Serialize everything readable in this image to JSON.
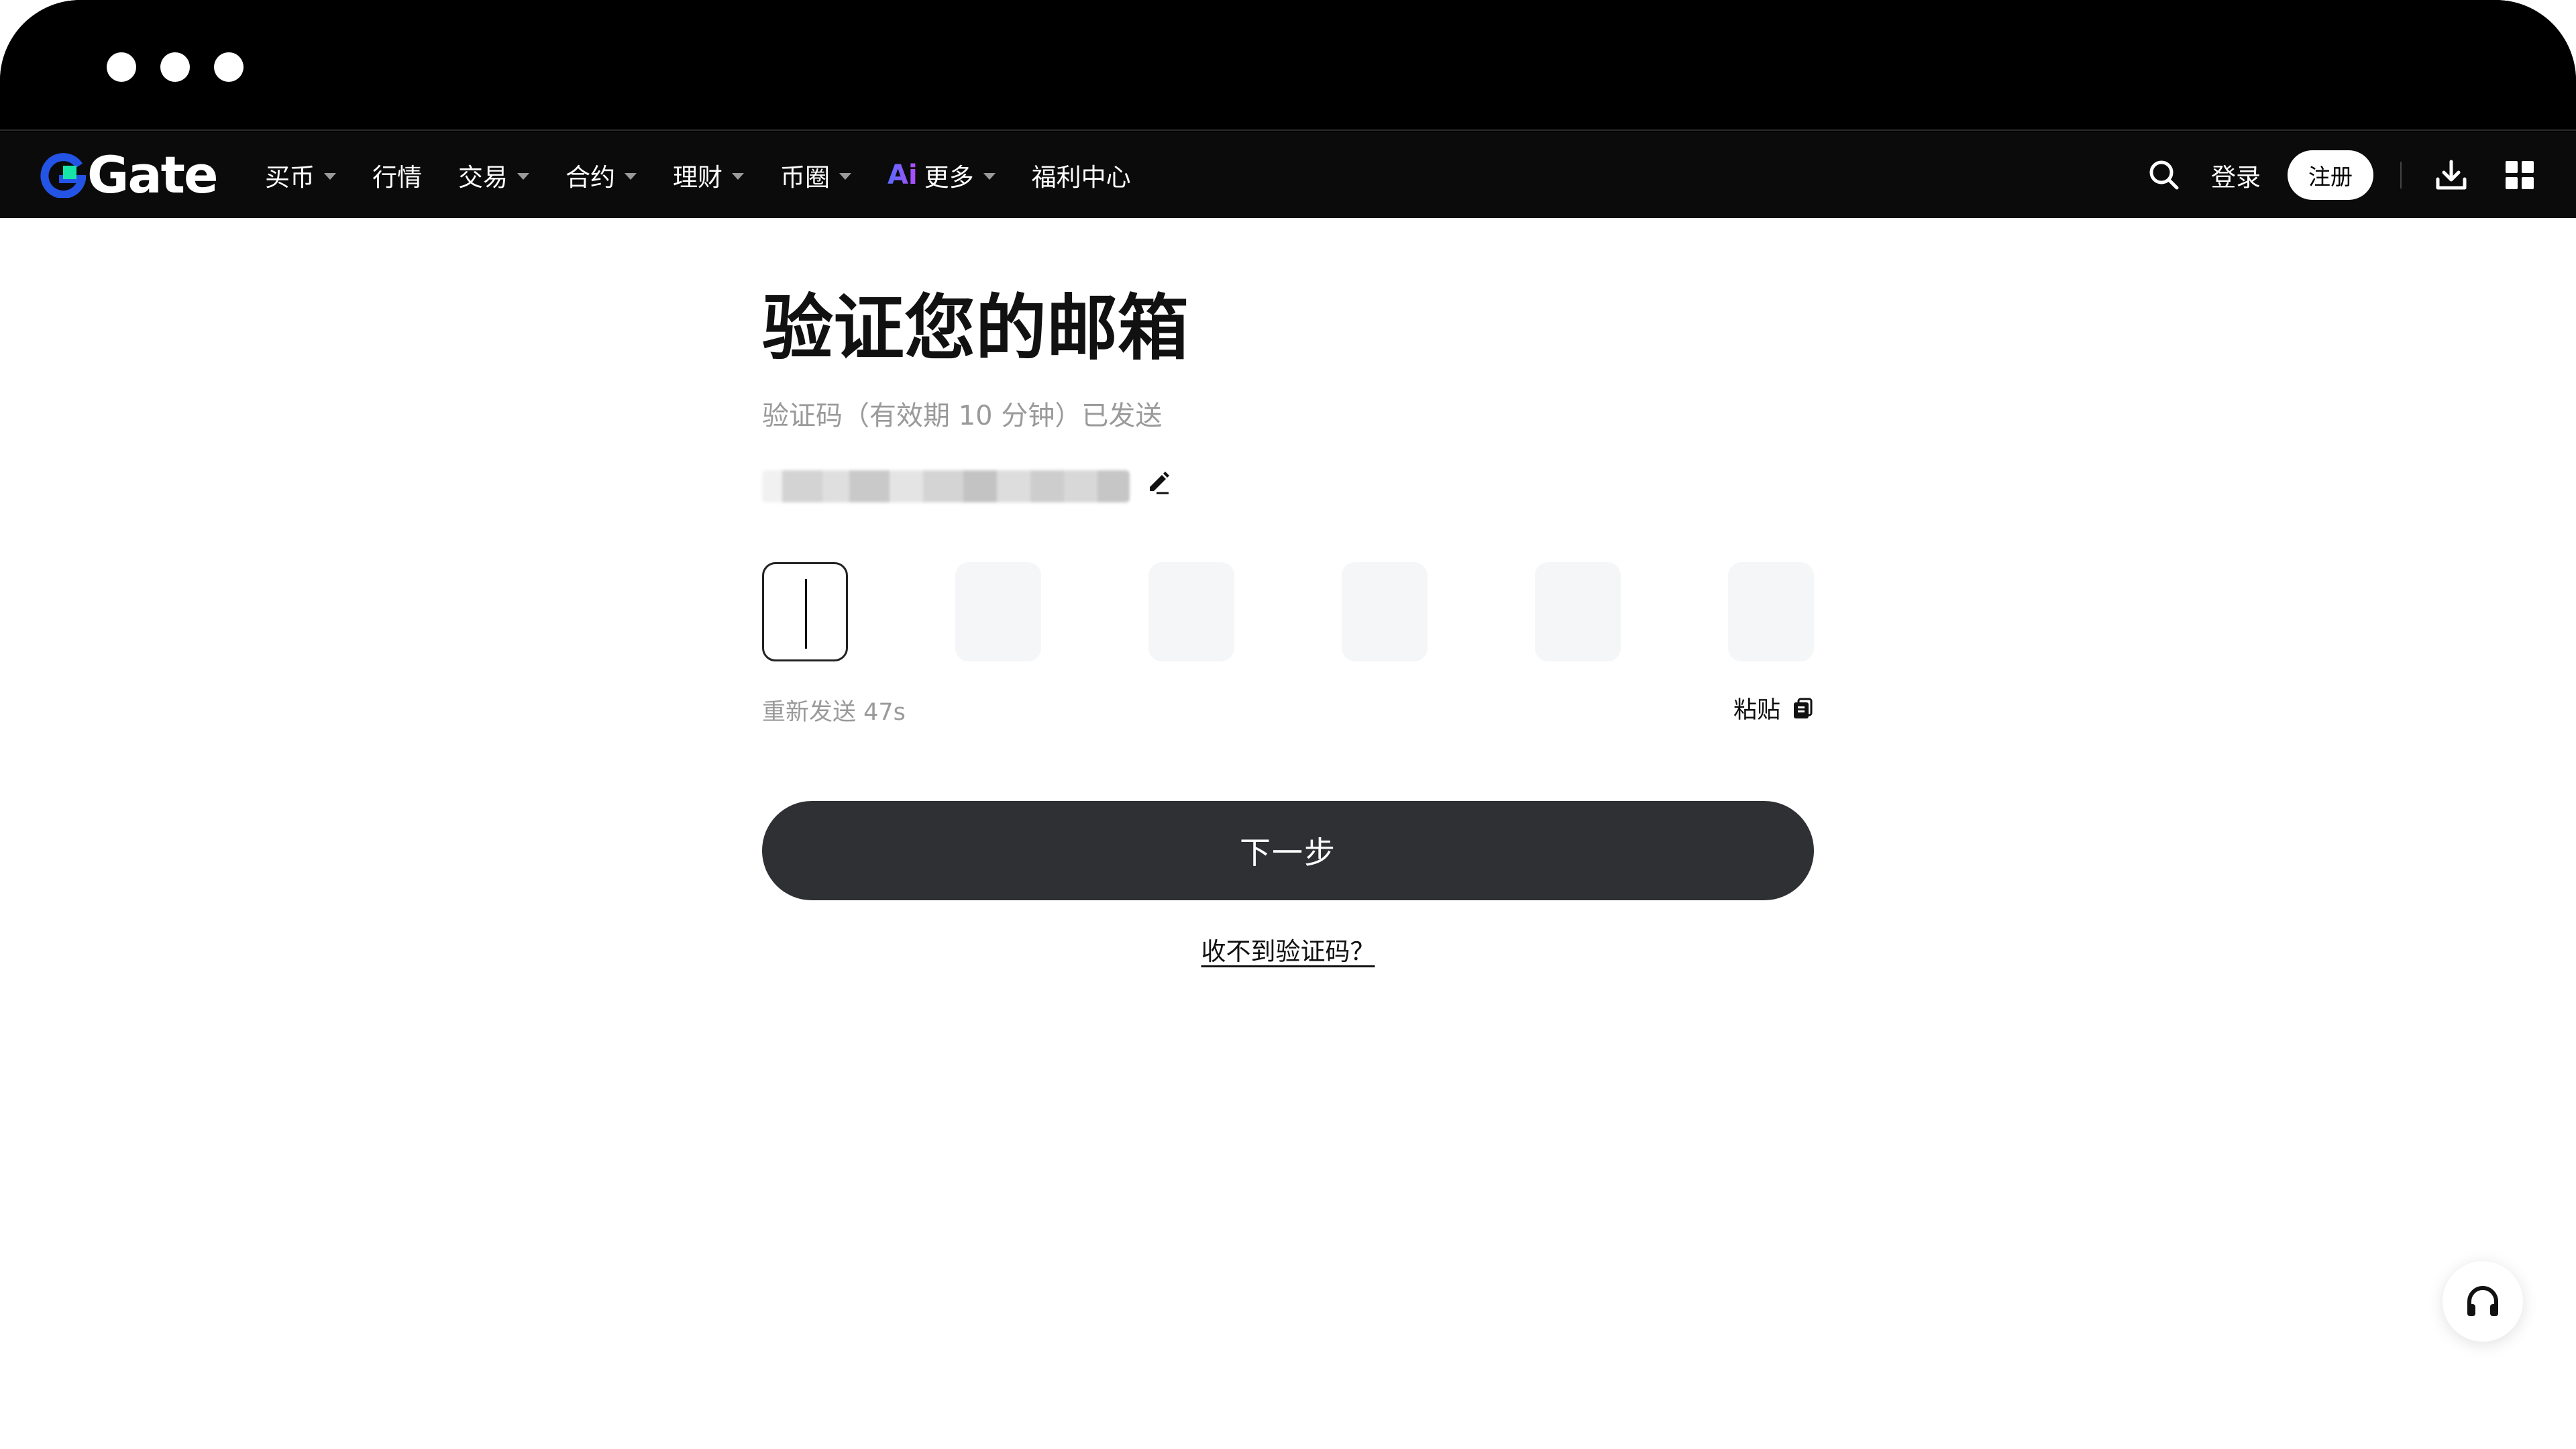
{
  "window": {
    "controls": [
      "close",
      "minimize",
      "maximize"
    ]
  },
  "nav": {
    "logo_text": "Gate",
    "logo_icon": "gate-logo-icon",
    "items": [
      {
        "label": "买币",
        "has_dropdown": true
      },
      {
        "label": "行情",
        "has_dropdown": false
      },
      {
        "label": "交易",
        "has_dropdown": true
      },
      {
        "label": "合约",
        "has_dropdown": true
      },
      {
        "label": "理财",
        "has_dropdown": true
      },
      {
        "label": "币圈",
        "has_dropdown": true
      },
      {
        "label": "更多",
        "has_dropdown": true,
        "badge": "Ai"
      },
      {
        "label": "福利中心",
        "has_dropdown": false
      }
    ],
    "search_icon": "search-icon",
    "login_label": "登录",
    "register_label": "注册",
    "download_icon": "download-icon",
    "apps_icon": "grid-icon"
  },
  "form": {
    "title": "验证您的邮箱",
    "subtitle": "验证码（有效期 10 分钟）已发送",
    "edit_icon": "edit-icon",
    "code_length": 6,
    "code_digits": [
      "",
      "",
      "",
      "",
      "",
      ""
    ],
    "active_index": 0,
    "resend_label": "重新发送 47s",
    "paste_label": "粘贴",
    "paste_icon": "clipboard-icon",
    "next_label": "下一步",
    "no_code_label": "收不到验证码？"
  },
  "support": {
    "icon": "headset-icon"
  },
  "colors": {
    "nav_bg": "#0b0b0b",
    "logo_blue": "#2354e6",
    "logo_cyan": "#17e5a8",
    "primary_button": "#2f3033",
    "muted_text": "#9a9a9a",
    "code_box_bg": "#f5f6f7"
  }
}
